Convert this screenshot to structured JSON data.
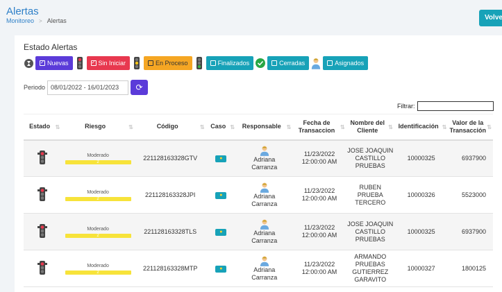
{
  "header": {
    "title": "Alertas",
    "breadcrumb": [
      "Monitoreo",
      "Alertas"
    ],
    "back_button": "Volver"
  },
  "card": {
    "title": "Estado Alertas",
    "status_filters": [
      {
        "label": "Nuevas",
        "color": "#5b3bd9",
        "icon": "traffic-light-red-icon"
      },
      {
        "label": "Sin Iniciar",
        "color": "#e8384f",
        "icon": "traffic-light-yellow-icon"
      },
      {
        "label": "En Proceso",
        "color": "#f5a623",
        "icon": "traffic-light-green-icon"
      },
      {
        "label": "Finalizados",
        "color": "#17a2b8",
        "icon": "check-circle-icon"
      },
      {
        "label": "Cerradas",
        "color": "#17a2b8",
        "icon": "user-avatar-icon"
      },
      {
        "label": "Asignados",
        "color": "#17a2b8"
      }
    ],
    "period_label": "Periodo",
    "period_value": "08/01/2022 - 16/01/2023",
    "filter_label": "Filtrar:"
  },
  "table": {
    "columns": [
      "Estado",
      "Riesgo",
      "Código",
      "Caso",
      "Responsable",
      "Fecha de Transaccion",
      "Nombre del Cliente",
      "Identificación",
      "Valor de la Transacción"
    ],
    "rows": [
      {
        "risk": "Moderado",
        "risk_level": "2",
        "code": "221128163328GTV",
        "responsible": "Adriana Carranza",
        "date": "11/23/2022 12:00:00 AM",
        "client": "JOSE JOAQUIN CASTILLO PRUEBAS",
        "id": "10000325",
        "value": "6937900"
      },
      {
        "risk": "Moderado",
        "risk_level": "2",
        "code": "221128163328JPI",
        "responsible": "Adriana Carranza",
        "date": "11/23/2022 12:00:00 AM",
        "client": "RUBEN PRUEBA TERCERO",
        "id": "10000326",
        "value": "5523000"
      },
      {
        "risk": "Moderado",
        "risk_level": "2",
        "code": "221128163328TLS",
        "responsible": "Adriana Carranza",
        "date": "11/23/2022 12:00:00 AM",
        "client": "JOSE JOAQUIN CASTILLO PRUEBAS",
        "id": "10000325",
        "value": "6937900"
      },
      {
        "risk": "Moderado",
        "risk_level": "2",
        "code": "221128163328MTP",
        "responsible": "Adriana Carranza",
        "date": "11/23/2022 12:00:00 AM",
        "client": "ARMANDO PRUEBAS GUTIERREZ GARAVITO",
        "id": "10000327",
        "value": "1800125"
      }
    ]
  }
}
